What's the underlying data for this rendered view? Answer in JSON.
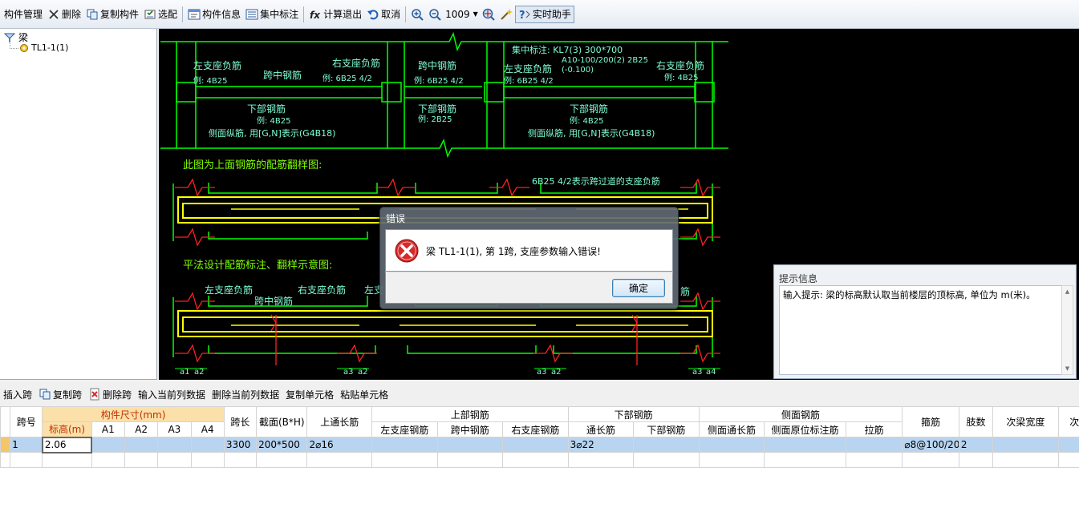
{
  "toolbar": {
    "items": [
      {
        "label": "构件管理"
      },
      {
        "label": "删除"
      },
      {
        "label": "复制构件"
      },
      {
        "label": "选配"
      },
      {
        "label": "构件信息"
      },
      {
        "label": "集中标注"
      },
      {
        "label": "计算退出"
      },
      {
        "label": "取消"
      }
    ],
    "zoom": "1009",
    "assistant_label": "实时助手"
  },
  "tree": {
    "root": "梁",
    "child": "TL1-1(1)"
  },
  "drawing": {
    "top": {
      "left_support": "左支座负筋",
      "left_support_eg": "例: 4B25",
      "mid1": "跨中钢筋",
      "right_support": "右支座负筋",
      "right_support_eg": "例: 6B25 4/2",
      "mid2": "跨中钢筋",
      "mid2_eg": "例: 6B25 4/2",
      "central_mark": "集中标注: KL7(3) 300*700",
      "central_mark2": "A10-100/200(2) 2B25",
      "central_mark3": "(-0.100)",
      "left_support2": "左支座负筋",
      "left_support2_eg": "例: 6B25 4/2",
      "right_support2": "右支座负筋",
      "right_support2_eg": "例: 4B25",
      "bottom1": "下部钢筋",
      "bottom1_eg": "例: 4B25",
      "side1": "侧面纵筋, 用[G,N]表示(G4B18)",
      "bottom2": "下部钢筋",
      "bottom2_eg": "例: 2B25",
      "bottom3": "下部钢筋",
      "bottom3_eg": "例: 4B25",
      "side2": "侧面纵筋, 用[G,N]表示(G4B18)"
    },
    "caption1": "此图为上面钢筋的配筋翻样图:",
    "note1": "6B25 4/2表示跨过道的支座负筋",
    "caption2": "平法设计配筋标注、翻样示意图:",
    "lower": {
      "left_support": "左支座负筋",
      "mid": "跨中钢筋",
      "right_support": "右支座负筋",
      "left_support2": "左支",
      "tail": "筋",
      "a1": "a1",
      "a2": "a2",
      "a3": "a3",
      "a4": "a4"
    }
  },
  "hint": {
    "title": "提示信息",
    "text": "输入提示: 梁的标高默认取当前楼层的顶标高, 单位为 m(米)。"
  },
  "dialog": {
    "title": "错误",
    "message": "梁 TL1-1(1), 第 1跨, 支座参数输入错误!",
    "ok_label": "确定"
  },
  "bottom_toolbar": {
    "items": [
      {
        "label": "插入跨"
      },
      {
        "label": "复制跨"
      },
      {
        "label": "删除跨"
      },
      {
        "label": "输入当前列数据"
      },
      {
        "label": "删除当前列数据"
      },
      {
        "label": "复制单元格"
      },
      {
        "label": "粘贴单元格"
      }
    ]
  },
  "grid": {
    "headers": {
      "span_no": "跨号",
      "dims": "构件尺寸(mm)",
      "elev": "标高(m)",
      "a1": "A1",
      "a2": "A2",
      "a3": "A3",
      "a4": "A4",
      "span_len": "跨长",
      "section": "截面(B*H)",
      "top_through": "上通长筋",
      "top_rebar": "上部钢筋",
      "top_left": "左支座钢筋",
      "top_mid": "跨中钢筋",
      "top_right": "右支座钢筋",
      "bottom_rebar": "下部钢筋",
      "bottom_through": "通长筋",
      "bottom_rebar2": "下部钢筋",
      "side_rebar": "侧面钢筋",
      "side_through": "侧面通长筋",
      "side_support": "侧面原位标注筋",
      "tie": "拉筋",
      "stirrup": "箍筋",
      "legs": "肢数",
      "sub_width": "次梁宽度",
      "sub_more": "次"
    },
    "rows": [
      {
        "no": "1",
        "elev": "2.06",
        "span_len": "3300",
        "section": "200*500",
        "top_through": "2⌀16",
        "bottom_through": "3⌀22",
        "stirrup": "⌀8@100/20",
        "legs": "2"
      }
    ]
  }
}
